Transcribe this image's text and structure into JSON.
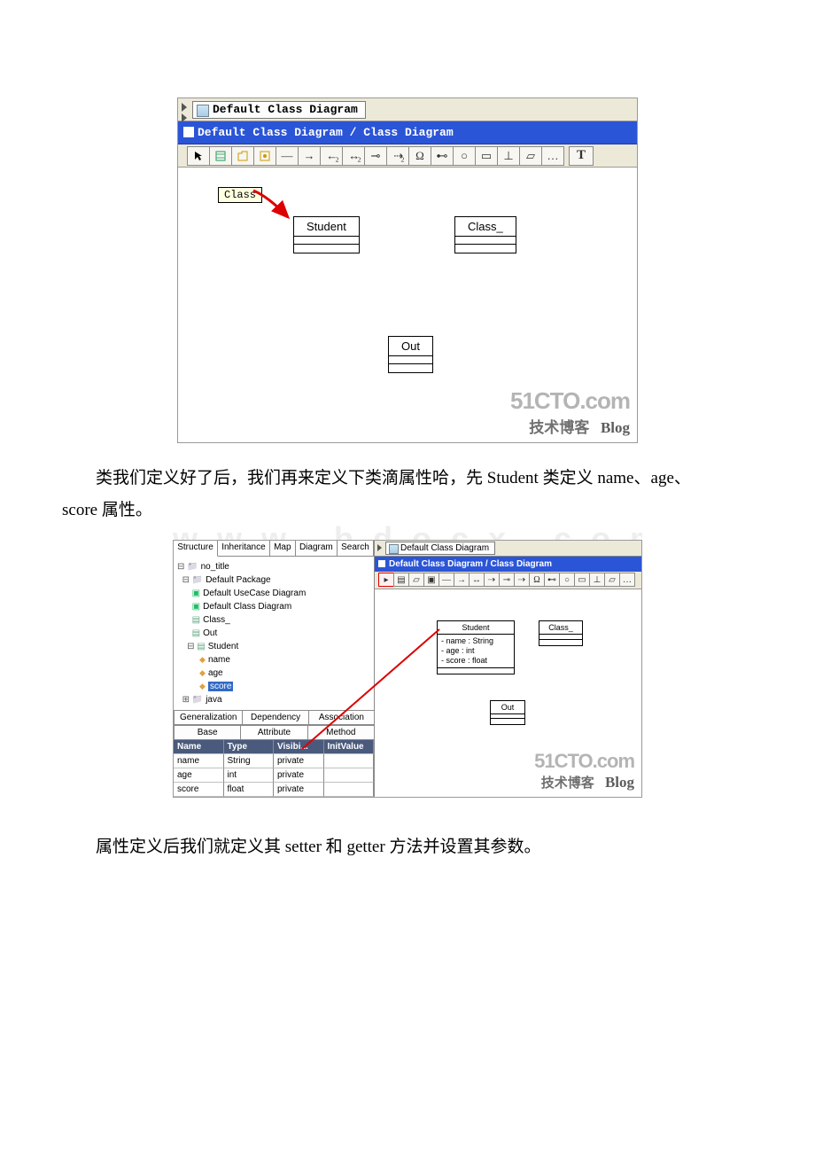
{
  "paragraphs": {
    "p1_pre": "类我们定义好了后，我们再来定义下类滴属性哈，先 ",
    "p1_mid1": "Student",
    "p1_mid2": " 类定义 ",
    "p1_mid3": "name",
    "p1_mid4": "、",
    "p1_mid5": "age",
    "p1_mid6": "、",
    "p1_end_pre": "score",
    "p1_end": " 属性。",
    "p2_pre": "属性定义后我们就定义其 ",
    "p2_mid1": "setter",
    "p2_mid2": " 和 ",
    "p2_mid3": "getter",
    "p2_end": " 方法并设置其参数。"
  },
  "shot1": {
    "tab_title": "Default Class Diagram",
    "breadcrumb": "Default Class Diagram / Class Diagram",
    "tooltip": "Class",
    "toolbar_T": "T",
    "uml": {
      "student": "Student",
      "class_": "Class_",
      "out": "Out"
    },
    "watermark": {
      "l1": "51CTO.com",
      "l2_pre": "技术博客",
      "l2_blog": "Blog"
    }
  },
  "shot2": {
    "left_tabs": [
      "Structure",
      "Inheritance",
      "Map",
      "Diagram",
      "Search"
    ],
    "tree": {
      "root": "no_title",
      "pkg": "Default Package",
      "uc": "Default UseCase Diagram",
      "cd": "Default Class Diagram",
      "c_class": "Class_",
      "c_out": "Out",
      "c_student": "Student",
      "a_name": "name",
      "a_age": "age",
      "a_score": "score",
      "java": "java"
    },
    "bottom_tabs_row1": [
      "Generalization",
      "Dependency",
      "Association"
    ],
    "bottom_tabs_row2": [
      "Base",
      "Attribute",
      "Method"
    ],
    "grid_headers": [
      "Name",
      "Type",
      "Visibi...",
      "InitValue"
    ],
    "grid_rows": [
      {
        "name": "name",
        "type": "String",
        "vis": "private",
        "init": ""
      },
      {
        "name": "age",
        "type": "int",
        "vis": "private",
        "init": ""
      },
      {
        "name": "score",
        "type": "float",
        "vis": "private",
        "init": ""
      }
    ],
    "right": {
      "tab_title": "Default Class Diagram",
      "breadcrumb": "Default Class Diagram / Class Diagram",
      "student": {
        "name": "Student",
        "attrs": [
          "- name : String",
          "- age : int",
          "- score : float"
        ]
      },
      "class_": "Class_",
      "out": "Out"
    },
    "watermark": {
      "l1": "51CTO.com",
      "l2_pre": "技术博客",
      "l2_blog": "Blog"
    }
  },
  "ghost_text": "w w w . b d o c x . c o m"
}
